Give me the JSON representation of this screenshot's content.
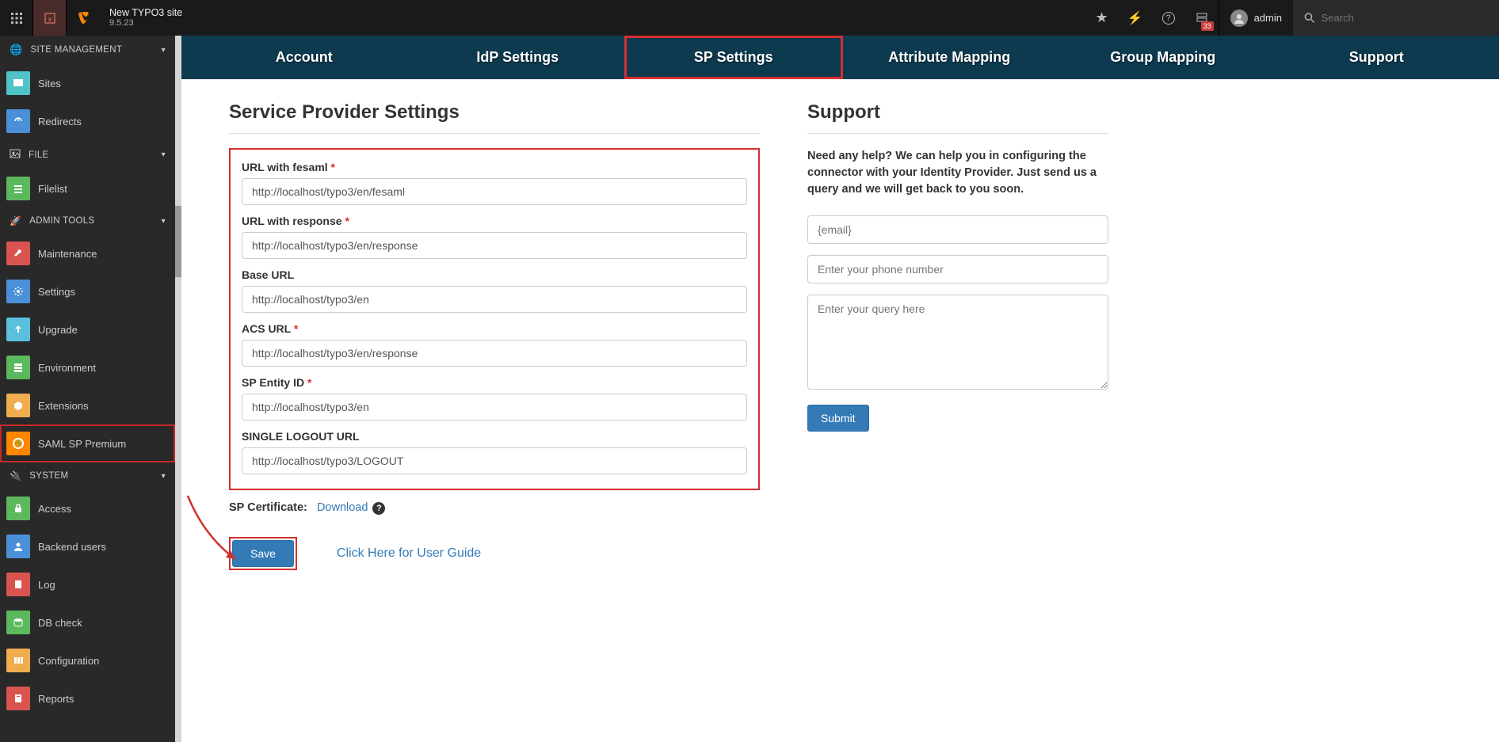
{
  "topbar": {
    "site_title": "New TYPO3 site",
    "version": "9.5.23",
    "notification_badge": "33",
    "user_name": "admin",
    "search_placeholder": "Search"
  },
  "sidebar": {
    "sections": {
      "site_mgmt": {
        "label": "SITE MANAGEMENT"
      },
      "file": {
        "label": "FILE"
      },
      "admin_tools": {
        "label": "ADMIN TOOLS"
      },
      "system": {
        "label": "SYSTEM"
      }
    },
    "items": {
      "sites": "Sites",
      "redirects": "Redirects",
      "filelist": "Filelist",
      "maintenance": "Maintenance",
      "settings": "Settings",
      "upgrade": "Upgrade",
      "environment": "Environment",
      "extensions": "Extensions",
      "saml": "SAML SP Premium",
      "access": "Access",
      "backend_users": "Backend users",
      "log": "Log",
      "db_check": "DB check",
      "configuration": "Configuration",
      "reports": "Reports"
    }
  },
  "tabs": {
    "account": "Account",
    "idp": "IdP Settings",
    "sp": "SP Settings",
    "attr": "Attribute Mapping",
    "group": "Group Mapping",
    "support": "Support"
  },
  "page": {
    "heading": "Service Provider Settings",
    "fields": {
      "fesaml": {
        "label": "URL with fesaml",
        "value": "http://localhost/typo3/en/fesaml"
      },
      "response": {
        "label": "URL with response",
        "value": "http://localhost/typo3/en/response"
      },
      "base": {
        "label": "Base URL",
        "value": "http://localhost/typo3/en"
      },
      "acs": {
        "label": "ACS URL",
        "value": "http://localhost/typo3/en/response"
      },
      "entity": {
        "label": "SP Entity ID",
        "value": "http://localhost/typo3/en"
      },
      "logout": {
        "label": "SINGLE LOGOUT URL",
        "value": "http://localhost/typo3/LOGOUT"
      }
    },
    "cert_label": "SP Certificate:",
    "download": "Download",
    "save": "Save",
    "user_guide": "Click Here for User Guide"
  },
  "support": {
    "heading": "Support",
    "text": "Need any help? We can help you in configuring the connector with your Identity Provider. Just send us a query and we will get back to you soon.",
    "email_placeholder": "{email}",
    "phone_placeholder": "Enter your phone number",
    "query_placeholder": "Enter your query here",
    "submit": "Submit"
  }
}
